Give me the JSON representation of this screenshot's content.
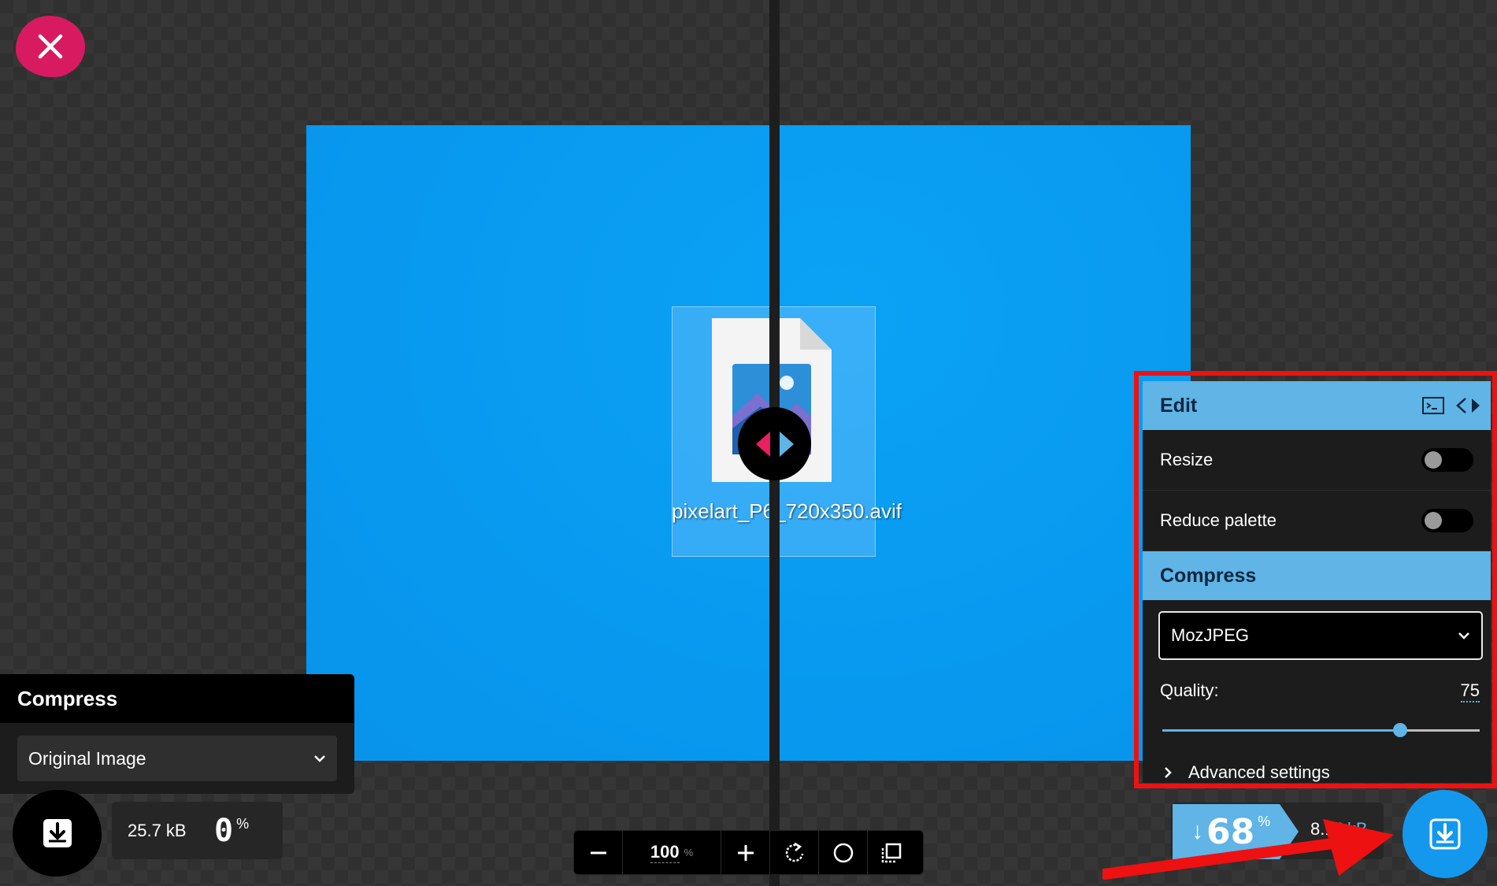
{
  "file": {
    "caption": "pixelart_P6_720x350.avif"
  },
  "left_panel": {
    "title": "Compress",
    "select_value": "Original Image",
    "size_value": "25.7 kB",
    "reduction_value": "0",
    "reduction_sign": "%"
  },
  "zoom": {
    "level": "100",
    "unit": "%"
  },
  "right_panel": {
    "edit_title": "Edit",
    "resize_label": "Resize",
    "reduce_palette_label": "Reduce palette",
    "compress_title": "Compress",
    "codec_value": "MozJPEG",
    "quality_label": "Quality:",
    "quality_value": "75",
    "quality_fraction": 0.75,
    "advanced_label": "Advanced settings"
  },
  "right_result": {
    "arrow": "↓",
    "reduction_value": "68",
    "reduction_sign": "%",
    "size_value": "8.18",
    "size_unit": "kB"
  },
  "colors": {
    "accent_blue": "#60b4e6",
    "close_pink": "#d81b60",
    "highlight_red": "#ee1111",
    "canvas_blue": "#0899ef"
  }
}
